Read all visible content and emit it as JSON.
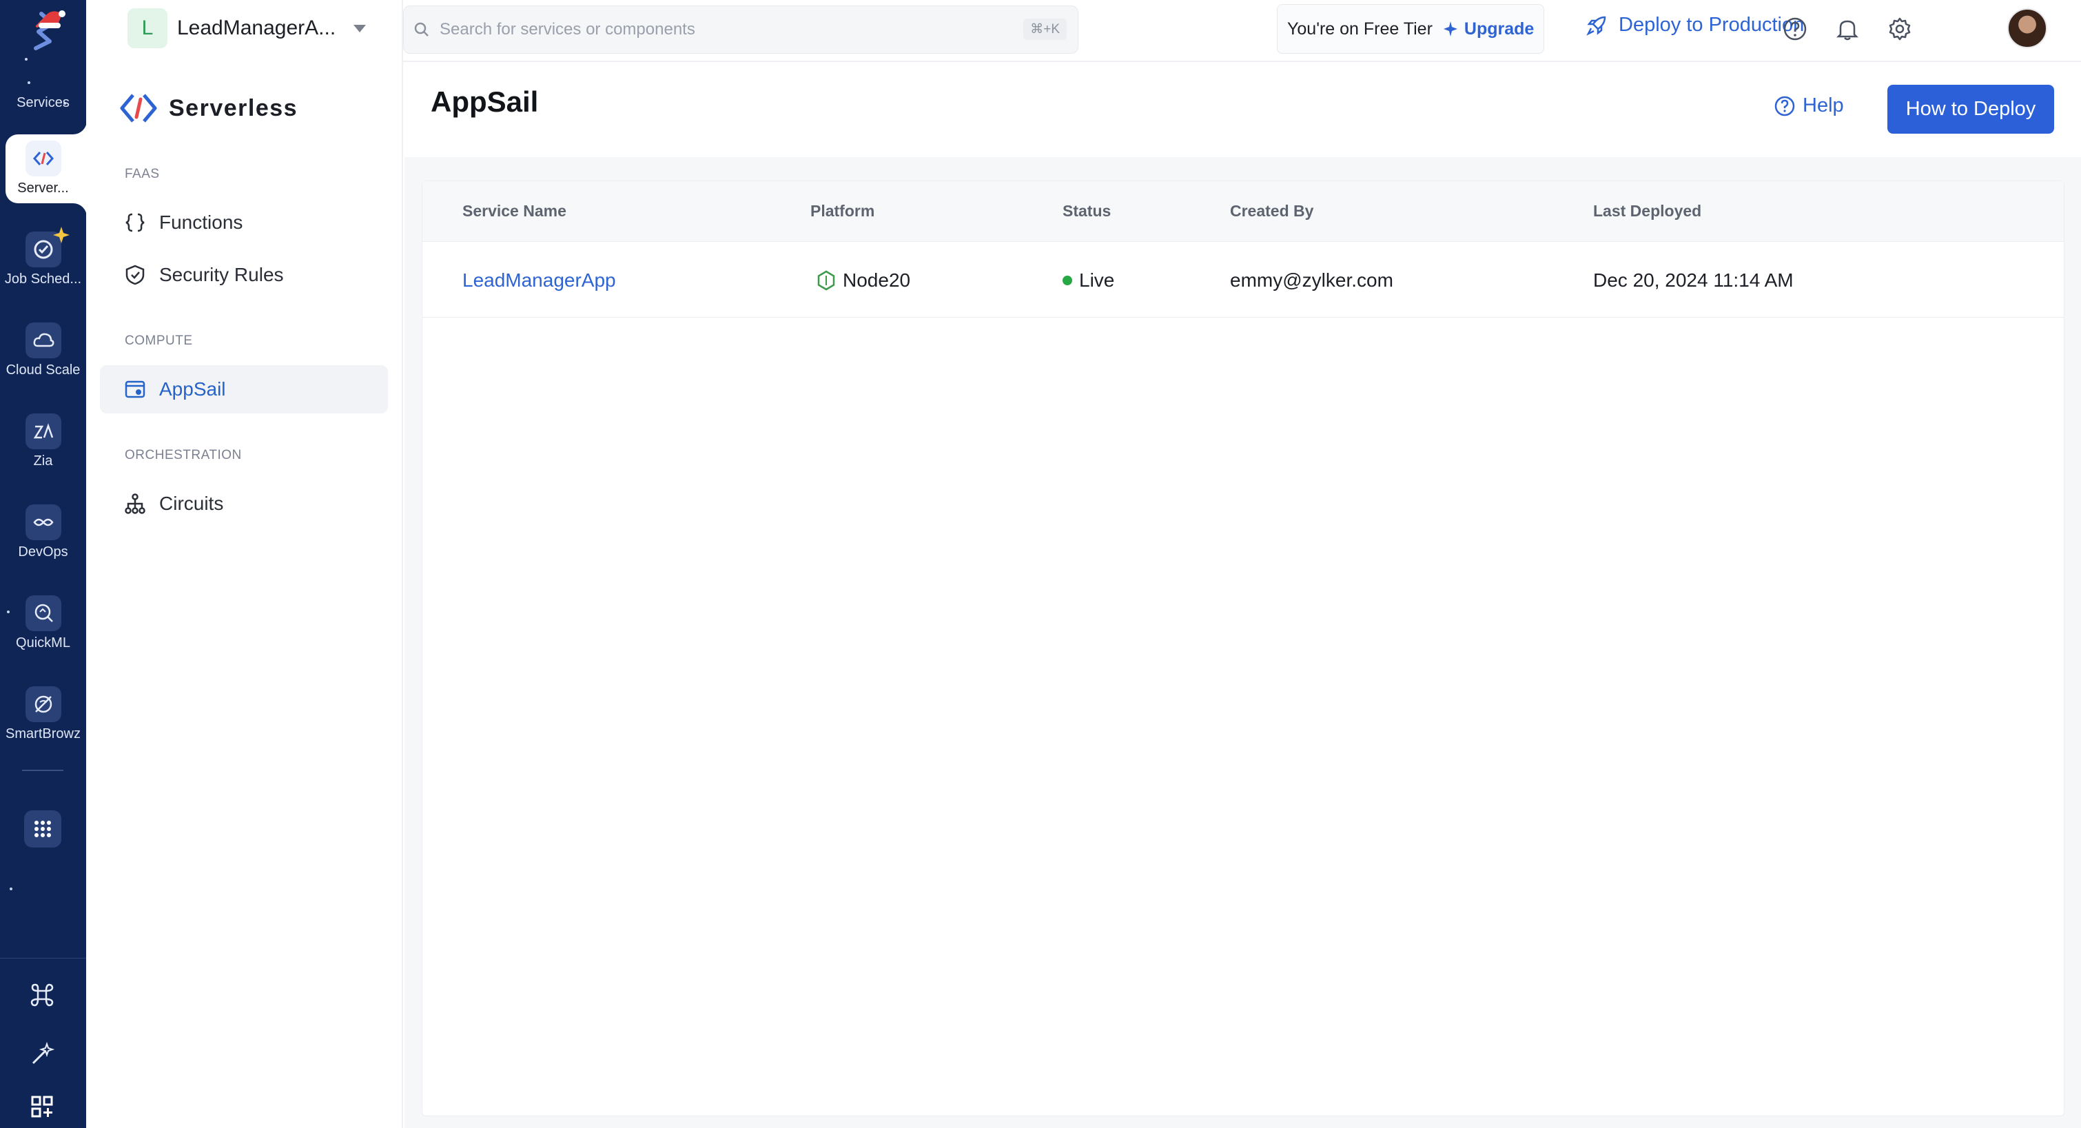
{
  "rail": {
    "items": [
      {
        "label": "Services",
        "icon": "services-icon"
      },
      {
        "label": "Server...",
        "icon": "serverless-icon"
      },
      {
        "label": "Job Sched...",
        "icon": "job-scheduling-icon"
      },
      {
        "label": "Cloud Scale",
        "icon": "cloud-scale-icon"
      },
      {
        "label": "Zia",
        "icon": "zia-icon"
      },
      {
        "label": "DevOps",
        "icon": "devops-icon"
      },
      {
        "label": "QuickML",
        "icon": "quickml-icon"
      },
      {
        "label": "SmartBrowz",
        "icon": "smartbrowz-icon"
      }
    ],
    "accent": "#0f2556"
  },
  "project": {
    "initial": "L",
    "name": "LeadManagerA..."
  },
  "sidebar": {
    "title": "Serverless",
    "sections": {
      "faas": "FAAS",
      "compute": "COMPUTE",
      "orchestration": "ORCHESTRATION"
    },
    "items": {
      "functions": "Functions",
      "security_rules": "Security Rules",
      "appsail": "AppSail",
      "circuits": "Circuits"
    }
  },
  "topbar": {
    "search_placeholder": "Search for services or components",
    "shortcut": "⌘+K",
    "tier_text": "You're on Free Tier",
    "upgrade": "Upgrade",
    "deploy": "Deploy to Production"
  },
  "main": {
    "title": "AppSail",
    "help": "Help",
    "how_to_deploy": "How to Deploy",
    "columns": {
      "service_name": "Service Name",
      "platform": "Platform",
      "status": "Status",
      "created_by": "Created By",
      "last_deployed": "Last Deployed"
    },
    "rows": [
      {
        "service_name": "LeadManagerApp",
        "platform": "Node20",
        "status": "Live",
        "created_by": "emmy@zylker.com",
        "last_deployed": "Dec 20, 2024 11:14 AM"
      }
    ]
  },
  "colors": {
    "primary": "#2c60d8",
    "live": "#28a745",
    "rail": "#0f2556"
  }
}
